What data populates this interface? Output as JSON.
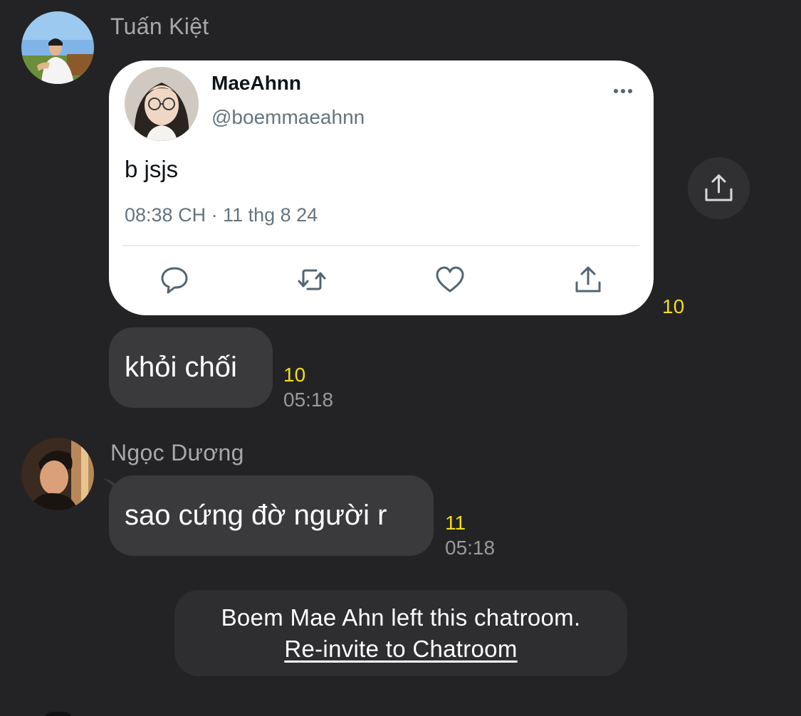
{
  "messages": [
    {
      "sender": "Tuấn Kiệt",
      "avatar_icon": "user-avatar-photo",
      "tweet": {
        "display_name": "MaeAhnn",
        "handle": "@boemmaeahnn",
        "text": "b jsjs",
        "timestamp": "08:38 CH · 11 thg 8 24",
        "actions": [
          "reply-icon",
          "retweet-icon",
          "like-icon",
          "share-icon"
        ],
        "more_icon": "more-options-icon"
      },
      "tweet_read_count": "10",
      "share_icon": "share-upload-icon"
    },
    {
      "text": "khỏi chối",
      "read_count": "10",
      "time": "05:18"
    },
    {
      "sender": "Ngọc Dương",
      "avatar_icon": "user-avatar-photo",
      "text": "sao cứng đờ người r",
      "read_count": "11",
      "time": "05:18"
    }
  ],
  "system_notice": {
    "text": "Boem Mae Ahn left this chatroom.",
    "link": "Re-invite to Chatroom"
  },
  "colors": {
    "background": "#232325",
    "bubble": "#3a3a3c",
    "read_count": "#f2dd1d",
    "muted_text": "#9a9a9d"
  }
}
